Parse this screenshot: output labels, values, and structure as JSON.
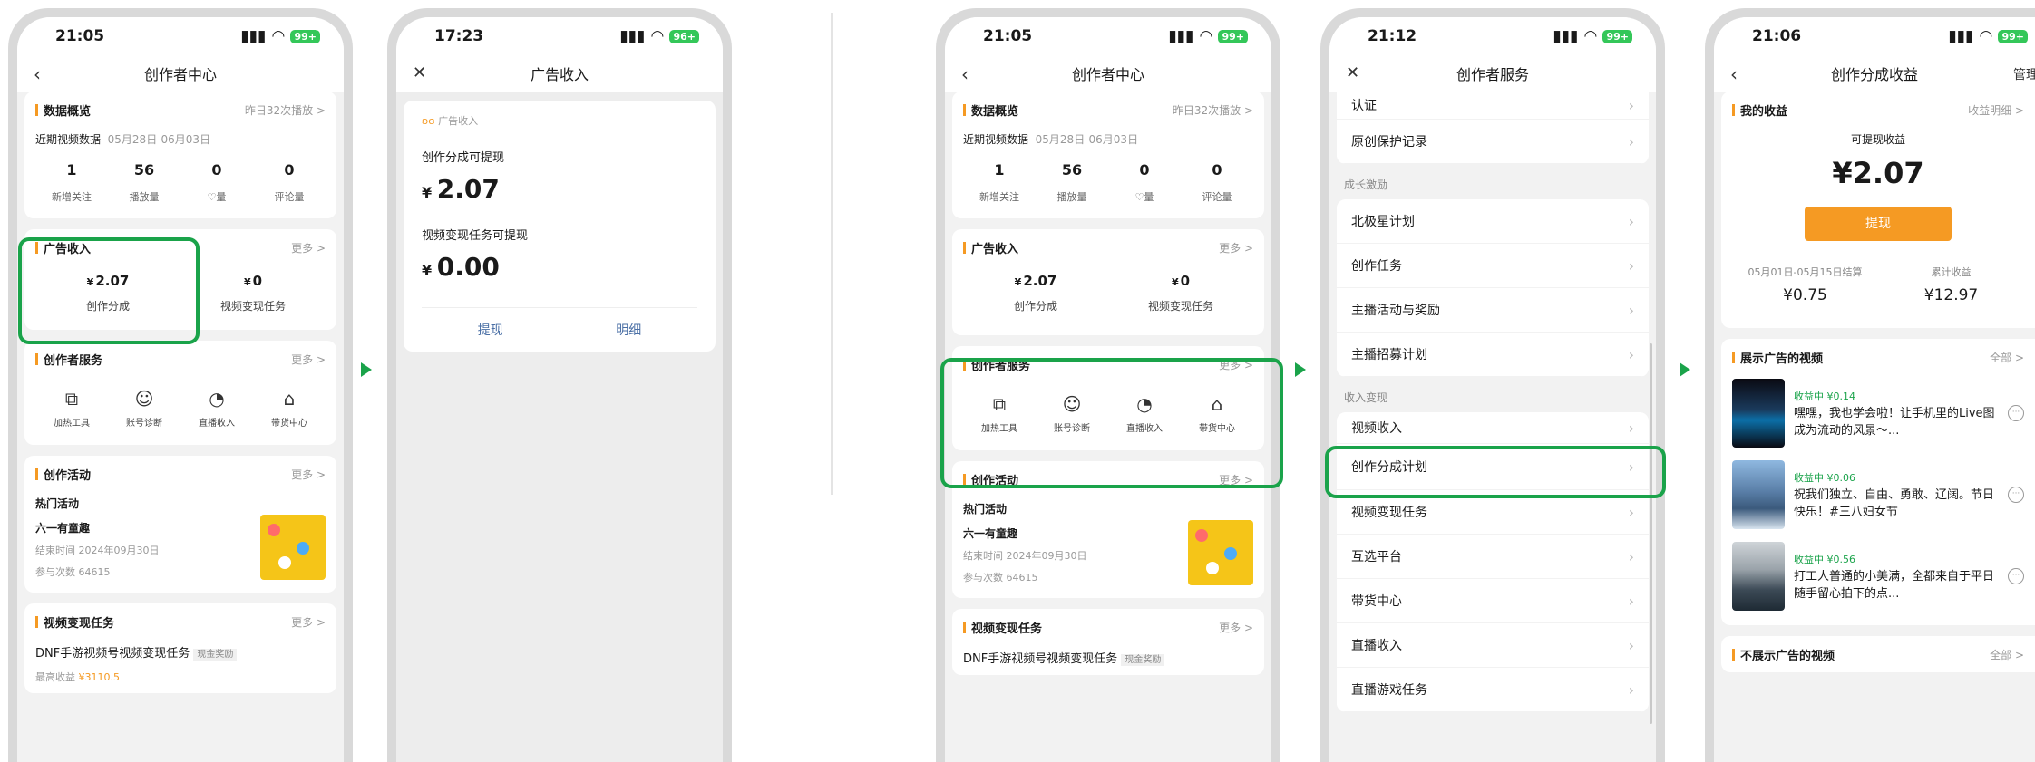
{
  "phone1": {
    "time": "21:05",
    "battery": "99+",
    "title": "创作者中心",
    "overview": {
      "title": "数据概览",
      "more": "昨日32次播放 >",
      "range_label": "近期视频数据",
      "range": "05月28日-06月03日",
      "stats": [
        {
          "n": "1",
          "l": "新增关注"
        },
        {
          "n": "56",
          "l": "播放量"
        },
        {
          "n": "0",
          "l": "♡量"
        },
        {
          "n": "0",
          "l": "评论量"
        }
      ]
    },
    "ad": {
      "title": "广告收入",
      "more": "更多 >",
      "v1_sym": "¥",
      "v1": "2.07",
      "l1": "创作分成",
      "v2_sym": "¥",
      "v2": "0",
      "l2": "视频变现任务"
    },
    "service": {
      "title": "创作者服务",
      "more": "更多 >",
      "tools": [
        "加热工具",
        "账号诊断",
        "直播收入",
        "带货中心"
      ]
    },
    "activity": {
      "title": "创作活动",
      "more": "更多 >",
      "hot": "热门活动",
      "name": "六一有童趣",
      "end": "结束时间  2024年09月30日",
      "count": "参与次数  64615"
    },
    "task": {
      "title": "视频变现任务",
      "more": "更多 >",
      "name": "DNF手游视频号视频变现任务",
      "badge": "现金奖励",
      "sub": "最高收益",
      "amt": "¥3110.5"
    }
  },
  "phone2": {
    "time": "17:23",
    "battery": "96+",
    "title": "广告收入",
    "label": "广告收入",
    "share_label": "创作分成可提现",
    "share_sym": "¥",
    "share": "2.07",
    "task_label": "视频变现任务可提现",
    "task_sym": "¥",
    "task": "0.00",
    "btn1": "提现",
    "btn2": "明细"
  },
  "phone3": {
    "time": "21:05",
    "battery": "99+",
    "title": "创作者中心",
    "overview": {
      "title": "数据概览",
      "more": "昨日32次播放 >",
      "range_label": "近期视频数据",
      "range": "05月28日-06月03日",
      "stats": [
        {
          "n": "1",
          "l": "新增关注"
        },
        {
          "n": "56",
          "l": "播放量"
        },
        {
          "n": "0",
          "l": "♡量"
        },
        {
          "n": "0",
          "l": "评论量"
        }
      ]
    },
    "ad": {
      "title": "广告收入",
      "more": "更多 >",
      "v1_sym": "¥",
      "v1": "2.07",
      "l1": "创作分成",
      "v2_sym": "¥",
      "v2": "0",
      "l2": "视频变现任务"
    },
    "service": {
      "title": "创作者服务",
      "more": "更多 >",
      "tools": [
        "加热工具",
        "账号诊断",
        "直播收入",
        "带货中心"
      ]
    },
    "activity": {
      "title": "创作活动",
      "more": "更多 >",
      "hot": "热门活动",
      "name": "六一有童趣",
      "end": "结束时间  2024年09月30日",
      "count": "参与次数  64615"
    },
    "task": {
      "title": "视频变现任务",
      "more": "更多 >",
      "name": "DNF手游视频号视频变现任务",
      "badge": "现金奖励"
    }
  },
  "phone4": {
    "time": "21:12",
    "battery": "99+",
    "title": "创作者服务",
    "top": [
      "认证",
      "原创保护记录"
    ],
    "sec1": "成长激励",
    "growth": [
      "北极星计划",
      "创作任务",
      "主播活动与奖励",
      "主播招募计划"
    ],
    "sec2": "收入变现",
    "income": [
      "视频收入",
      "创作分成计划",
      "视频变现任务",
      "互选平台",
      "带货中心",
      "直播收入",
      "直播游戏任务"
    ]
  },
  "phone5": {
    "time": "21:06",
    "battery": "99+",
    "title": "创作分成收益",
    "manage": "管理",
    "earn_title": "我的收益",
    "earn_more": "收益明细 >",
    "avail_label": "可提现收益",
    "avail": "¥2.07",
    "withdraw": "提现",
    "settle_label": "05月01日-05月15日结算",
    "settle": "¥0.75",
    "total_label": "累计收益",
    "total": "¥12.97",
    "videos_title": "展示广告的视频",
    "videos_more": "全部 >",
    "videos": [
      {
        "earn": "收益中  ¥0.14",
        "text": "嘿嘿，我也学会啦！让手机里的Live图成为流动的风景～..."
      },
      {
        "earn": "收益中  ¥0.06",
        "text": "祝我们独立、自由、勇敢、辽阔。节日快乐！#三八妇女节"
      },
      {
        "earn": "收益中  ¥0.56",
        "text": "打工人普通的小美满，全都来自于平日随手留心拍下的点..."
      }
    ],
    "noad_title": "不展示广告的视频",
    "noad_more": "全部 >"
  },
  "colors": {
    "accent": "#1aa34a",
    "orange": "#f59a23",
    "link": "#4a6fa5"
  }
}
